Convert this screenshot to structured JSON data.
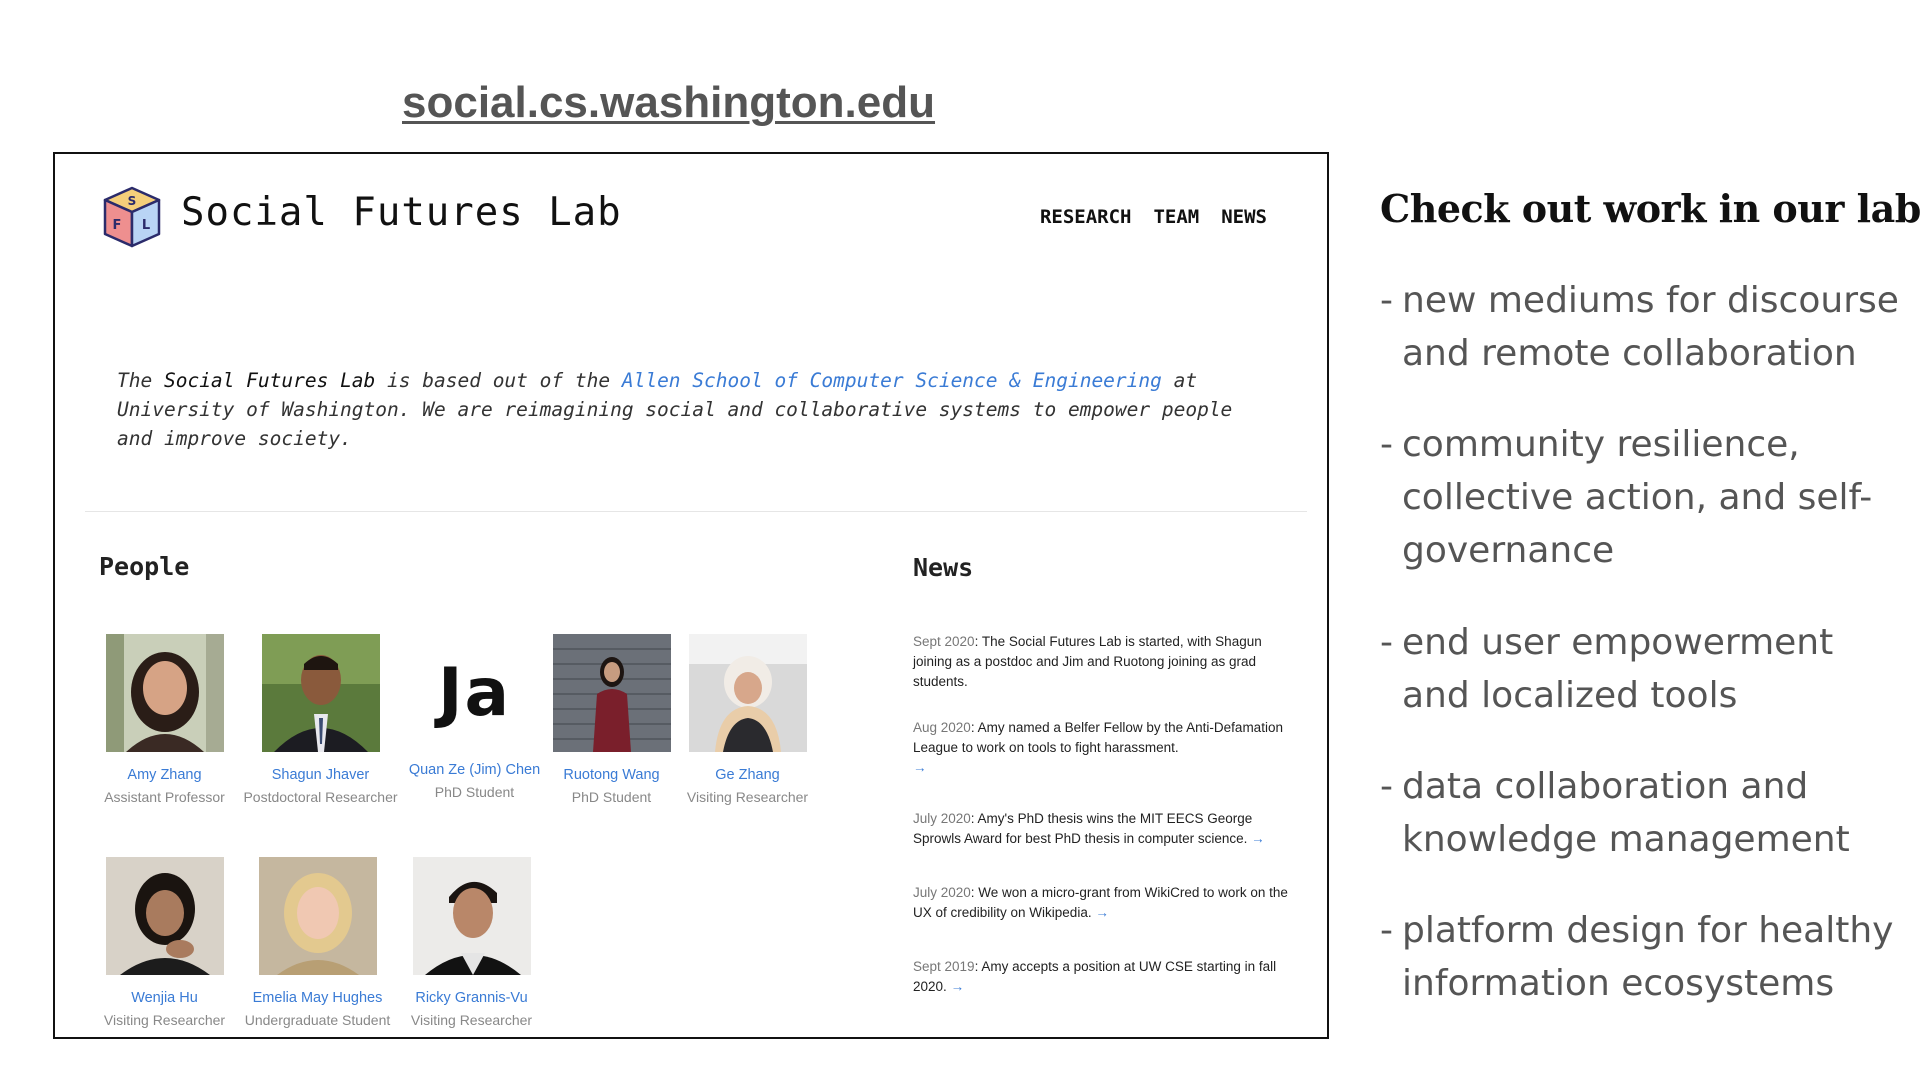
{
  "url": "social.cs.washington.edu",
  "site": {
    "title": "Social Futures Lab",
    "logo_letters": [
      "S",
      "F",
      "L"
    ],
    "nav": [
      "RESEARCH",
      "TEAM",
      "NEWS"
    ],
    "intro": {
      "pre": "The ",
      "lab": "Social Futures Lab",
      "mid": " is based out of the ",
      "link": "Allen School of Computer Science & Engineering",
      "post": " at University of Washington. We are reimagining social and collaborative systems to empower people and improve society."
    },
    "people_heading": "People",
    "news_heading": "News",
    "people": [
      {
        "name": "Amy Zhang",
        "role": "Assistant Professor"
      },
      {
        "name": "Shagun Jhaver",
        "role": "Postdoctoral Researcher"
      },
      {
        "name": "Quan Ze (Jim) Chen",
        "role": "PhD Student",
        "photo_text": "Ja"
      },
      {
        "name": "Ruotong Wang",
        "role": "PhD Student"
      },
      {
        "name": "Ge Zhang",
        "role": "Visiting Researcher"
      },
      {
        "name": "Wenjia Hu",
        "role": "Visiting Researcher"
      },
      {
        "name": "Emelia May Hughes",
        "role": "Undergraduate Student"
      },
      {
        "name": "Ricky Grannis-Vu",
        "role": "Visiting Researcher"
      }
    ],
    "news": [
      {
        "date": "Sept 2020",
        "text": ": The Social Futures Lab is started, with Shagun joining as a postdoc and Jim and Ruotong joining as grad students.",
        "arrow": ""
      },
      {
        "date": "Aug 2020",
        "text": ": Amy named a Belfer Fellow by the Anti-Defamation League to work on tools to fight harassment.",
        "arrow": "→"
      },
      {
        "date": "July 2020",
        "text": ": Amy's PhD thesis wins the MIT EECS George Sprowls Award for best PhD thesis in computer science.",
        "arrow": "→"
      },
      {
        "date": "July 2020",
        "text": ": We won a micro-grant from WikiCred to work on the UX of credibility on Wikipedia.",
        "arrow": "→"
      },
      {
        "date": "Sept 2019",
        "text": ": Amy accepts a position at UW CSE starting in fall 2020.",
        "arrow": "→"
      }
    ]
  },
  "panel": {
    "title": "Check out work in our lab!",
    "dash": "-",
    "bullets": [
      "new mediums for discourse and remote collaboration",
      "community resilience, collective action, and self-governance",
      "end user empowerment and localized tools",
      "data collaboration and knowledge management",
      "platform design for healthy information ecosystems"
    ]
  },
  "colors": {
    "link": "#3a7bd5",
    "muted": "#888888",
    "panel_text": "#555555"
  },
  "icons": {
    "logo": "sfl-cube-logo-icon",
    "arrow": "arrow-right-icon"
  }
}
